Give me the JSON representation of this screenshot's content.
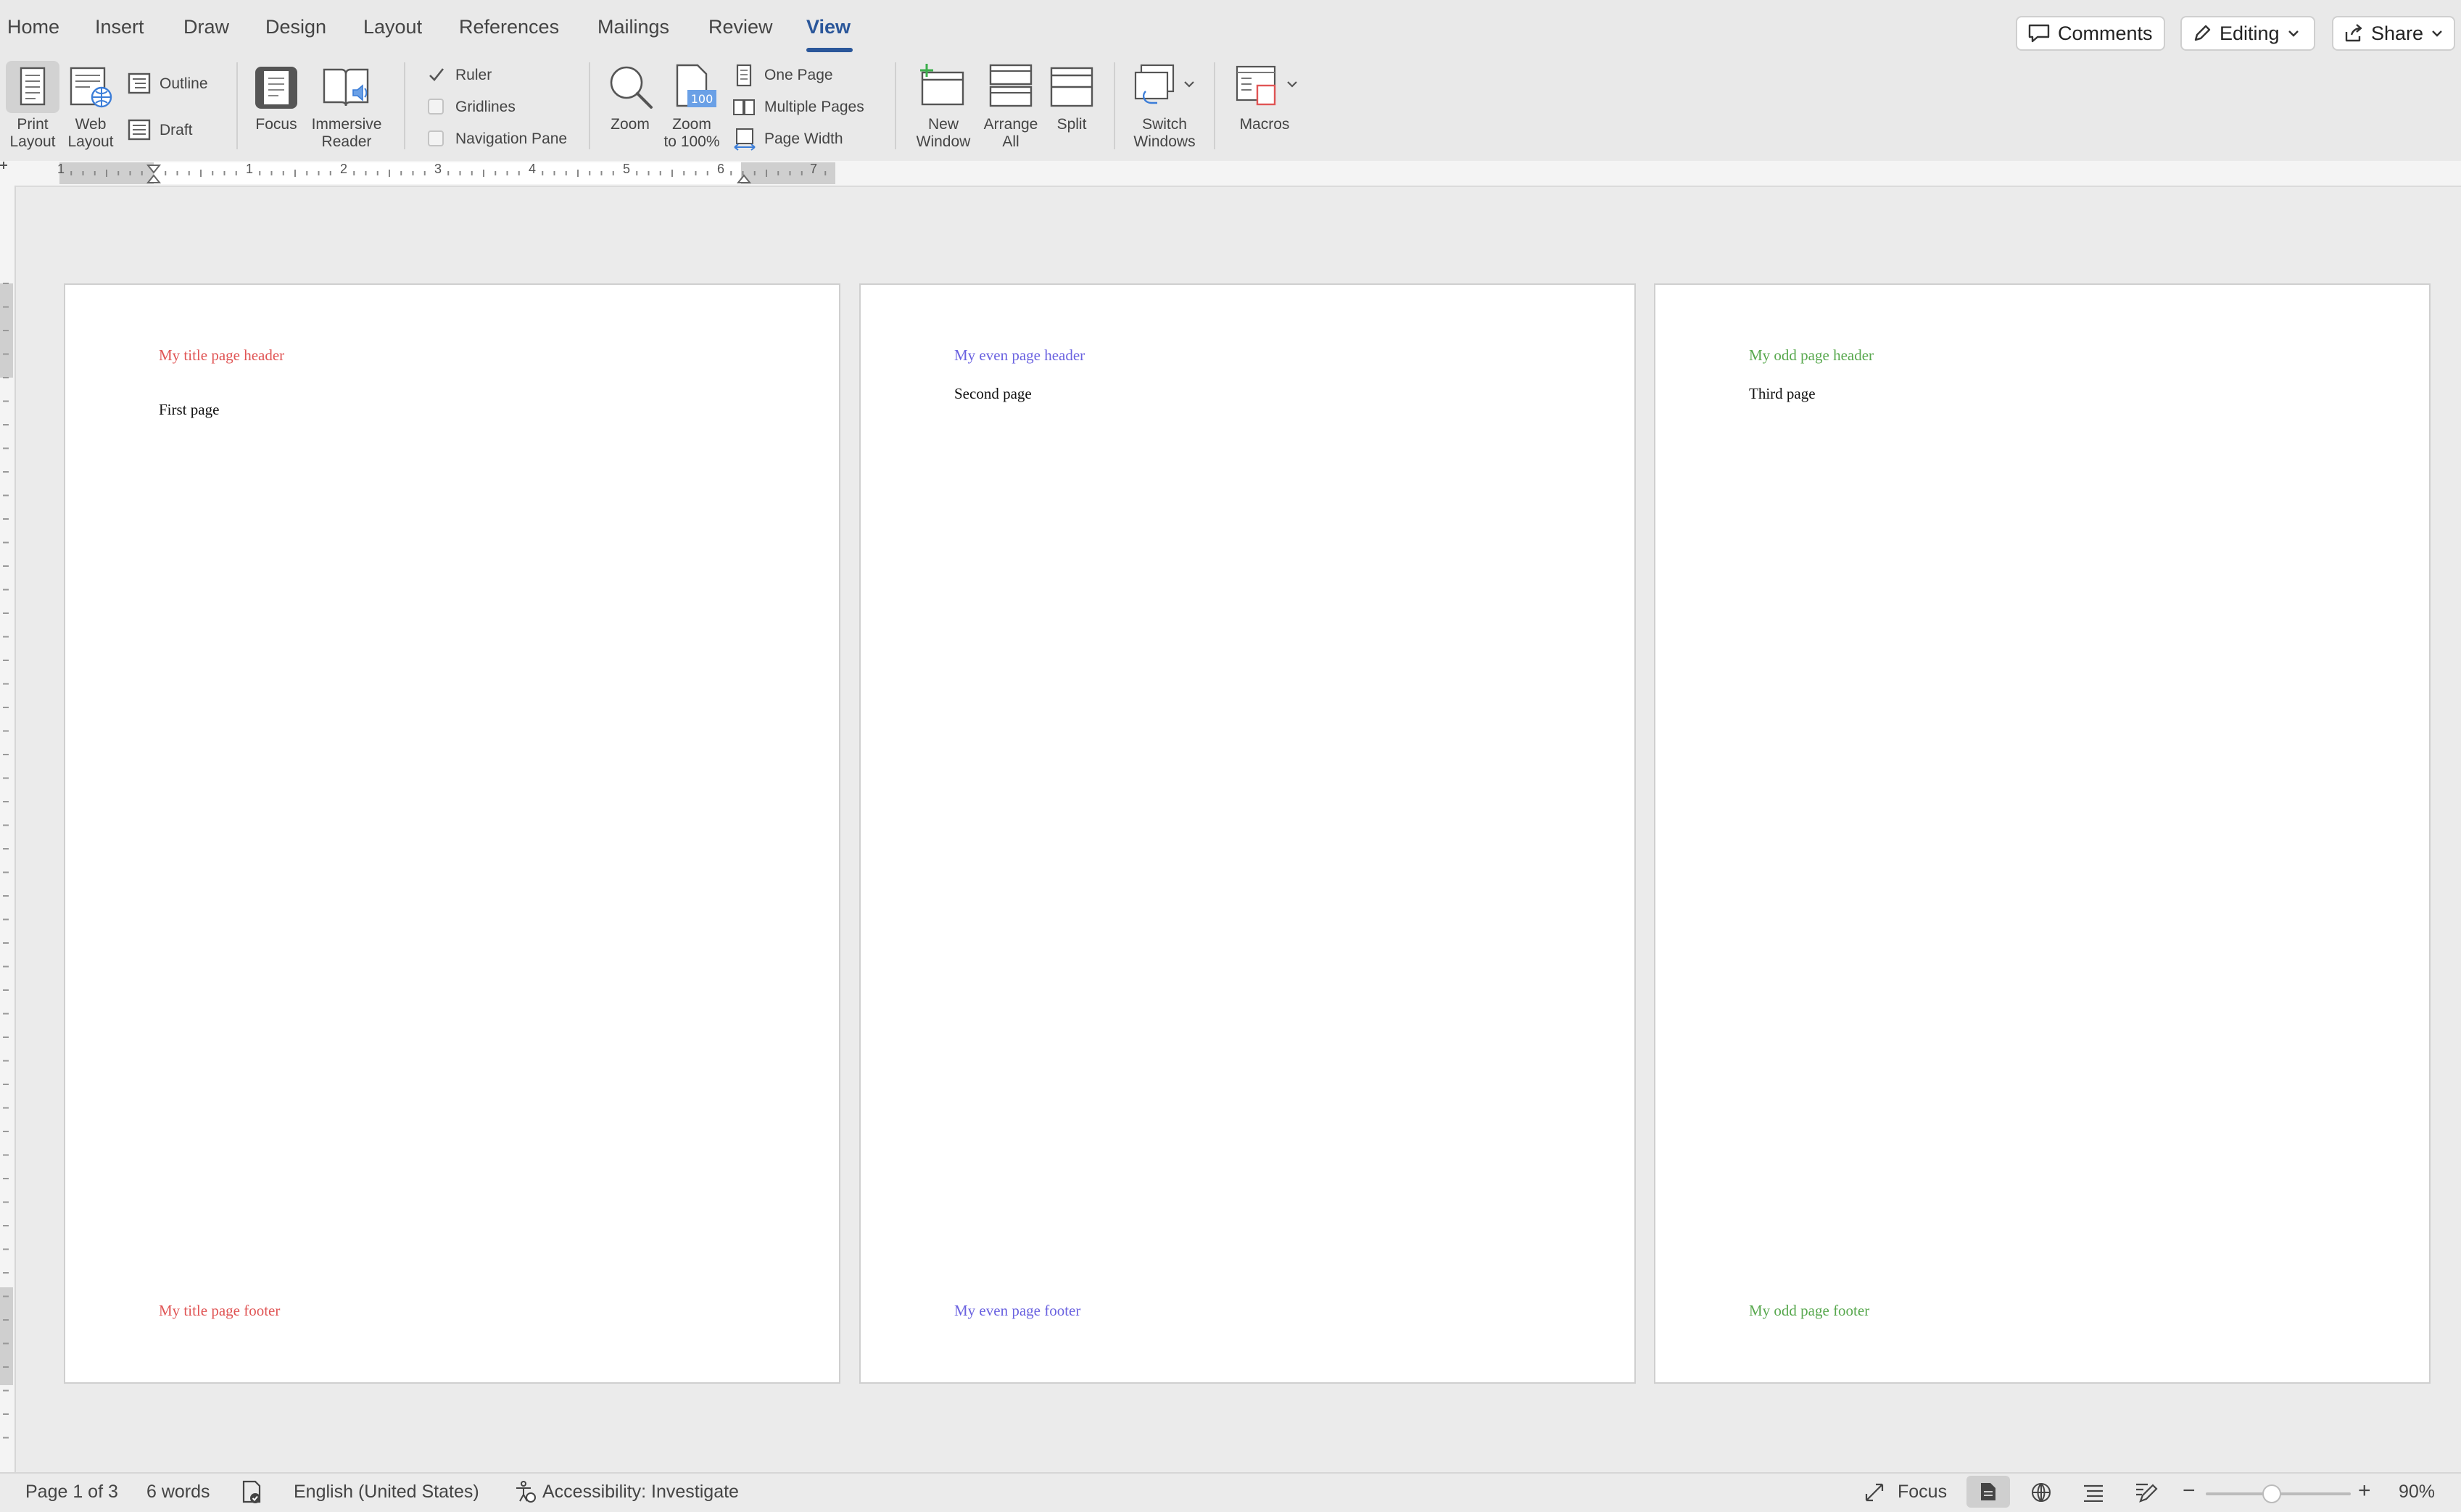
{
  "tabs": [
    {
      "label": "Home"
    },
    {
      "label": "Insert"
    },
    {
      "label": "Draw"
    },
    {
      "label": "Design"
    },
    {
      "label": "Layout"
    },
    {
      "label": "References"
    },
    {
      "label": "Mailings"
    },
    {
      "label": "Review"
    },
    {
      "label": "View"
    }
  ],
  "active_tab": "View",
  "top_buttons": {
    "comments": "Comments",
    "editing": "Editing",
    "share": "Share"
  },
  "ribbon": {
    "print_layout": [
      "Print",
      "Layout"
    ],
    "web_layout": [
      "Web",
      "Layout"
    ],
    "outline": "Outline",
    "draft": "Draft",
    "focus": "Focus",
    "immersive_reader": [
      "Immersive",
      "Reader"
    ],
    "ruler": "Ruler",
    "gridlines": "Gridlines",
    "navigation_pane": "Navigation Pane",
    "zoom": "Zoom",
    "zoom_100": [
      "Zoom",
      "to 100%"
    ],
    "one_page": "One Page",
    "multiple_pages": "Multiple Pages",
    "page_width": "Page Width",
    "new_window": [
      "New",
      "Window"
    ],
    "arrange_all": [
      "Arrange",
      "All"
    ],
    "split": "Split",
    "switch_windows": [
      "Switch",
      "Windows"
    ],
    "macros": "Macros",
    "checkboxes": {
      "ruler": true,
      "gridlines": false,
      "navigation_pane": false
    }
  },
  "ruler_numbers": [
    "1",
    "1",
    "2",
    "3",
    "4",
    "5",
    "6",
    "7"
  ],
  "pages": [
    {
      "header": "My title page header",
      "body": "First page",
      "footer": "My title page footer",
      "color": "#e05555"
    },
    {
      "header": "My even page header",
      "body": "Second page",
      "footer": "My even page footer",
      "color": "#6a62e0"
    },
    {
      "header": "My odd page header",
      "body": "Third page",
      "footer": "My odd page footer",
      "color": "#58a84e"
    }
  ],
  "status": {
    "page": "Page 1 of 3",
    "words": "6 words",
    "language": "English (United States)",
    "accessibility": "Accessibility: Investigate",
    "focus": "Focus",
    "zoom": "90%"
  },
  "colors": {
    "accent": "#2b579a"
  }
}
